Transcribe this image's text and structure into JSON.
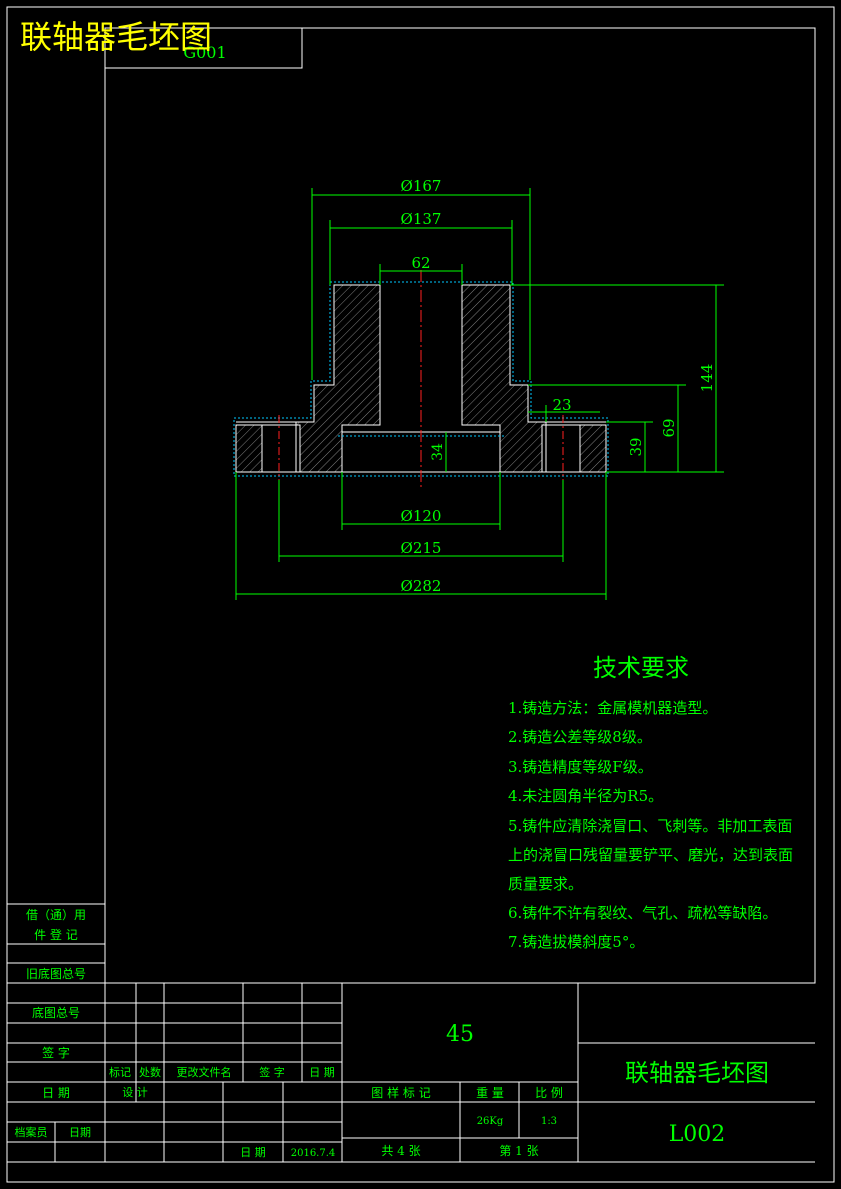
{
  "header": {
    "overlay_title": "联轴器毛坯图",
    "code_box": "G001"
  },
  "dimensions": {
    "d167": "Ø167",
    "d137": "Ø137",
    "w62": "62",
    "h144": "144",
    "w23": "23",
    "h69": "69",
    "h39": "39",
    "h34": "34",
    "d120": "Ø120",
    "d215": "Ø215",
    "d282": "Ø282"
  },
  "notes": {
    "title": "技术要求",
    "items": [
      "1.铸造方法：金属模机器造型。",
      "2.铸造公差等级8级。",
      "3.铸造精度等级F级。",
      "4.未注圆角半径为R5。",
      "5.铸件应清除浇冒口、飞刺等。非加工表面",
      "上的浇冒口残留量要铲平、磨光，达到表面",
      "质量要求。",
      "6.铸件不许有裂纹、气孔、疏松等缺陷。",
      "7.铸造拔模斜度5°。"
    ]
  },
  "side_table": {
    "tongyong": "借（通）用",
    "jianzheng": "件 登 记",
    "old_base": "旧底图总号",
    "base_total": "底图总号",
    "signature": "签 字",
    "date": "日 期",
    "archivist": "档案员",
    "date2": "日期"
  },
  "title_block": {
    "material": "45",
    "name": "联轴器毛坯图",
    "drawing_no": "L002",
    "mark": "标记",
    "count": "处数",
    "change_doc": "更改文件名",
    "sign": "签 字",
    "date": "日 期",
    "design": "设 计",
    "drawing_label": "图 样 标 记",
    "weight_label": "重 量",
    "scale_label": "比 例",
    "weight": "26Kg",
    "scale": "1:3",
    "date_label": "日 期",
    "date_value": "2016.7.4",
    "total": "共  4  张",
    "sheet": "第  1  张"
  }
}
